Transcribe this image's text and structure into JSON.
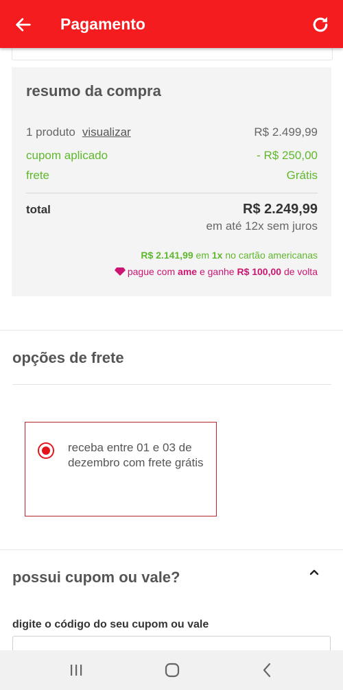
{
  "app_bar": {
    "title": "Pagamento",
    "back_icon": "arrow-left-icon",
    "refresh_icon": "refresh-icon",
    "color": "#f41c1f"
  },
  "summary": {
    "heading": "resumo da compra",
    "product_count": "1 produto",
    "view_link": "visualizar",
    "product_price": "R$ 2.499,99",
    "coupon_label": "cupom aplicado",
    "coupon_value": "- R$ 250,00",
    "shipping_label": "frete",
    "shipping_value": "Grátis",
    "total_label": "total",
    "total_value": "R$ 2.249,99",
    "installments": "em até 12x sem juros",
    "card_offer": {
      "amount": "R$ 2.141,99",
      "text_1": " em ",
      "times": "1x",
      "text_2": " no cartão americanas"
    },
    "ame_offer": {
      "text_1": "pague com ",
      "brand": "ame",
      "text_2": " e ganhe ",
      "cashback": "R$ 100,00",
      "text_3": " de volta"
    }
  },
  "shipping_options": {
    "heading": "opções de frete",
    "option_text": "receba entre 01 e 03 de dezembro com frete grátis",
    "selected": true
  },
  "coupon": {
    "heading": "possui cupom ou vale?",
    "input_label": "digite o código do seu cupom ou vale",
    "input_value": ""
  },
  "colors": {
    "green": "#5fb82c",
    "magenta": "#cc1573",
    "accent_red": "#e4141b"
  }
}
